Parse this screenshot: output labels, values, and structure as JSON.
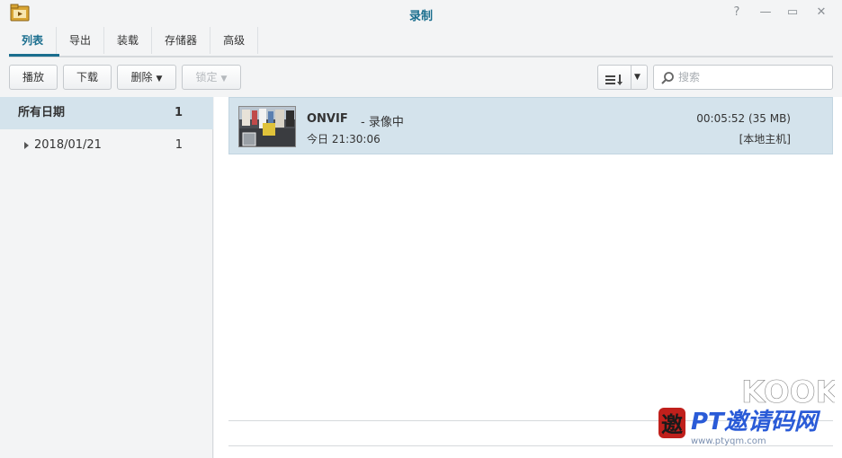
{
  "window": {
    "title": "录制",
    "icon": "film-folder-icon",
    "controls": {
      "help": "?",
      "minimize": "—",
      "maximize": "▭",
      "close": "✕"
    }
  },
  "tabs": [
    {
      "label": "列表",
      "active": true
    },
    {
      "label": "导出",
      "active": false
    },
    {
      "label": "装载",
      "active": false
    },
    {
      "label": "存储器",
      "active": false
    },
    {
      "label": "高级",
      "active": false
    }
  ],
  "toolbar": {
    "play_label": "播放",
    "download_label": "下载",
    "delete_label": "删除",
    "lock_label": "锁定",
    "sort_icon": "sort-list-icon",
    "search_placeholder": "搜索"
  },
  "sidebar": {
    "items": [
      {
        "label": "所有日期",
        "count": "1",
        "selected": true
      },
      {
        "label": "2018/01/21",
        "count": "1",
        "selected": false
      }
    ]
  },
  "recordings": [
    {
      "name": "ONVIF",
      "status": " - 录像中",
      "time": "今日 21:30:06",
      "duration": "00:05:52 (35 MB)",
      "host": "[本地主机]"
    }
  ],
  "watermark": {
    "logo_text": "KOOK",
    "site_text": "PT邀请码网",
    "seal_char": "邀",
    "url_text": "www.ptyqm.com"
  },
  "colors": {
    "accent": "#1a6e8e",
    "selected_bg": "#d4e3ec",
    "window_bg": "#f3f4f5",
    "content_bg": "#ffffff"
  }
}
